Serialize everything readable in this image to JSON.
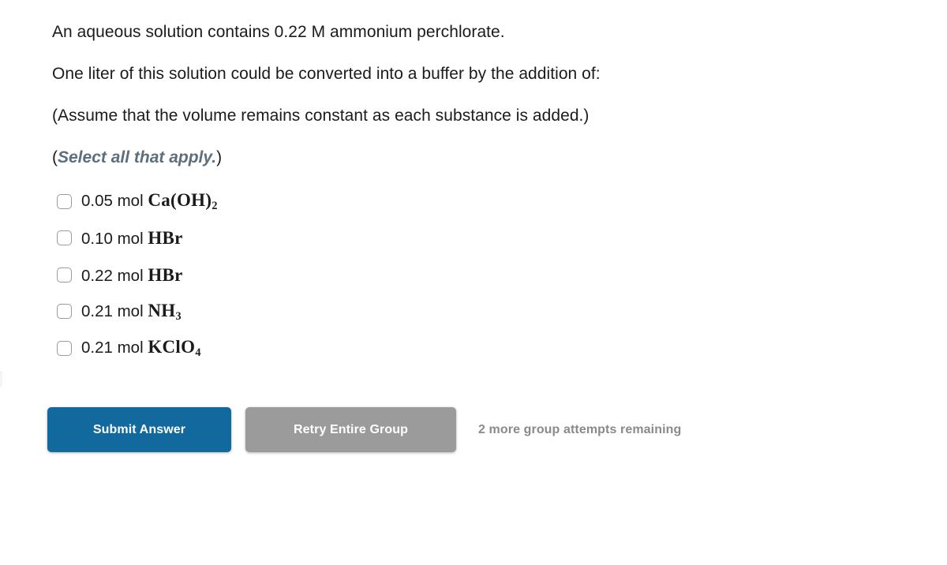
{
  "question": {
    "lines": [
      "An aqueous solution contains 0.22 M ammonium perchlorate.",
      "One liter of this solution could be converted into a buffer by the addition of:",
      "(Assume that the volume remains constant as each substance is added.)"
    ],
    "select_all": {
      "open_paren": "(",
      "emphasis": "Select all that apply.",
      "close_paren": ")",
      "emphasis_color": "#5d6e7d"
    }
  },
  "options": [
    {
      "amount": "0.05 mol ",
      "formula_parts": [
        {
          "text": "Ca(OH)",
          "sub": false
        },
        {
          "text": "2",
          "sub": true
        }
      ],
      "plain": "0.05 mol Ca(OH)2",
      "checked": false
    },
    {
      "amount": "0.10 mol ",
      "formula_parts": [
        {
          "text": "HBr",
          "sub": false
        }
      ],
      "plain": "0.10 mol HBr",
      "checked": false
    },
    {
      "amount": "0.22 mol ",
      "formula_parts": [
        {
          "text": "HBr",
          "sub": false
        }
      ],
      "plain": "0.22 mol HBr",
      "checked": false
    },
    {
      "amount": "0.21 mol ",
      "formula_parts": [
        {
          "text": "NH",
          "sub": false
        },
        {
          "text": "3",
          "sub": true
        }
      ],
      "plain": "0.21 mol NH3",
      "checked": false
    },
    {
      "amount": "0.21 mol ",
      "formula_parts": [
        {
          "text": "KClO",
          "sub": false
        },
        {
          "text": "4",
          "sub": true
        }
      ],
      "plain": "0.21 mol KClO4",
      "checked": false
    }
  ],
  "actions": {
    "submit_label": "Submit Answer",
    "retry_label": "Retry Entire Group",
    "attempts_text": "2 more group attempts remaining",
    "submit_color": "#12699d",
    "retry_color": "#9b9b9b",
    "attempts_color": "#8a8a8a"
  }
}
